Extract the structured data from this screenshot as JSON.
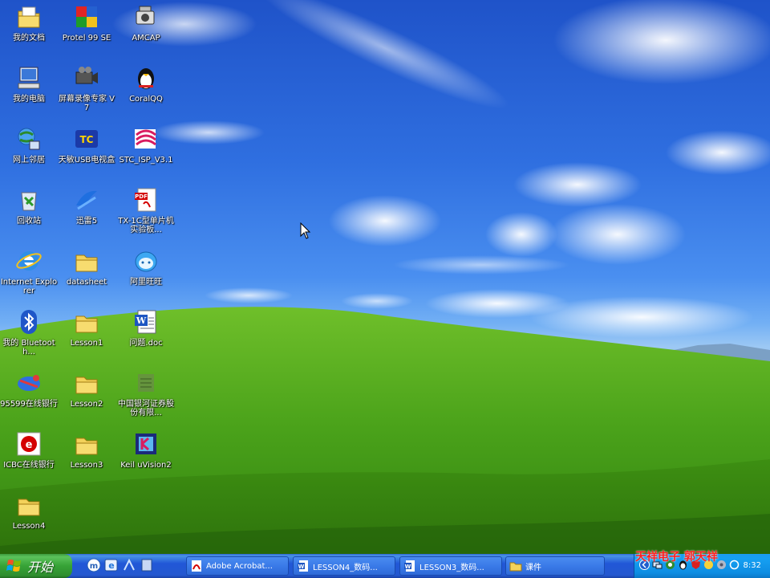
{
  "desktop": {
    "icons": [
      {
        "id": "my-documents",
        "label": "我的文档"
      },
      {
        "id": "protel",
        "label": "Protel 99 SE"
      },
      {
        "id": "amcap",
        "label": "AMCAP"
      },
      {
        "id": "my-computer",
        "label": "我的电脑"
      },
      {
        "id": "screen-recorder",
        "label": "屏幕录像专家 V7"
      },
      {
        "id": "coralqq",
        "label": "CoralQQ"
      },
      {
        "id": "network-places",
        "label": "网上邻居"
      },
      {
        "id": "tv-box",
        "label": "天敏USB电视盒"
      },
      {
        "id": "stc-isp",
        "label": "STC_ISP_V3.1"
      },
      {
        "id": "recycle-bin",
        "label": "回收站"
      },
      {
        "id": "xunlei",
        "label": "迅雷5"
      },
      {
        "id": "pdf-doc",
        "label": "TX-1C型单片机实验板..."
      },
      {
        "id": "ie",
        "label": "Internet Explorer"
      },
      {
        "id": "datasheet",
        "label": "datasheet"
      },
      {
        "id": "aliwangwang",
        "label": "阿里旺旺"
      },
      {
        "id": "bluetooth",
        "label": "我的 Bluetooth..."
      },
      {
        "id": "lesson1",
        "label": "Lesson1"
      },
      {
        "id": "wenti-doc",
        "label": "问题.doc"
      },
      {
        "id": "bank-95599",
        "label": "95599在线银行"
      },
      {
        "id": "lesson2",
        "label": "Lesson2"
      },
      {
        "id": "galaxy-securities",
        "label": "中国银河证券股份有限..."
      },
      {
        "id": "icbc",
        "label": "ICBC在线银行"
      },
      {
        "id": "lesson3",
        "label": "Lesson3"
      },
      {
        "id": "keil",
        "label": "Keil uVision2"
      },
      {
        "id": "lesson4",
        "label": "Lesson4"
      }
    ]
  },
  "taskbar": {
    "start_label": "开始",
    "quick_launch": [
      "maxthon-icon",
      "ie-icon",
      "show-desktop-icon",
      "media-icon"
    ],
    "tasks": [
      {
        "label": "Adobe Acrobat...",
        "icon": "pdf-icon"
      },
      {
        "label": "LESSON4_数码...",
        "icon": "word-icon"
      },
      {
        "label": "LESSON3_数码...",
        "icon": "word-icon"
      },
      {
        "label": "课件",
        "icon": "folder-icon"
      }
    ],
    "clock": "8:32"
  },
  "watermark": "天祥电子 郭天祥",
  "colors": {
    "taskbar_blue": "#2458d0",
    "start_green": "#36a236",
    "tray_blue": "#0d8ce2",
    "watermark_red": "#ff2020"
  }
}
